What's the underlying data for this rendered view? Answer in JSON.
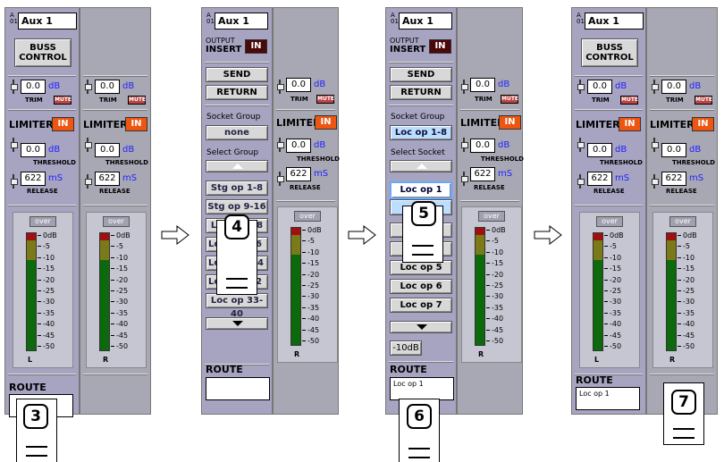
{
  "strip": {
    "channel_letter": "A",
    "channel_number": "01",
    "name": "Aux 1",
    "buss_control": "BUSS\nCONTROL",
    "trim_value": "0.0",
    "trim_unit": "dB",
    "trim_label": "TRIM",
    "mute_label": "MUTE",
    "limiter_label": "LIMITER",
    "in_label": "IN",
    "threshold_value": "0.0",
    "threshold_unit": "dB",
    "threshold_label": "THRESHOLD",
    "release_value": "622",
    "release_unit": "mS",
    "release_label": "RELEASE",
    "over_label": "over",
    "scale": [
      "0dB",
      "-5",
      "-10",
      "-15",
      "-20",
      "-25",
      "-30",
      "-35",
      "-40",
      "-45",
      "-50"
    ],
    "meter_left": "L",
    "meter_right": "R",
    "route_label": "ROUTE",
    "route_value": "Loc op 1"
  },
  "insert": {
    "output_label": "OUTPUT",
    "insert_label": "INSERT",
    "in_label": "IN",
    "send": "SEND",
    "return": "RETURN",
    "socket_group_label": "Socket Group",
    "socket_group_none": "none",
    "socket_group_sel": "Loc op 1-8",
    "select_group_label": "Select Group",
    "select_socket_label": "Select Socket",
    "groups": [
      "Stg op 1-8",
      "Stg op 9-16",
      "Loc op 1-8",
      "Loc op 9-16",
      "Loc op 17-24",
      "Loc op 25-32",
      "Loc op 33-40"
    ],
    "groups_visible": [
      "Stg op 1-8",
      "Stg op 9-16",
      "Loc op 1-8",
      "Lo",
      "6",
      "Loc",
      "24",
      "Lo",
      "32",
      "Loc op 33-40"
    ],
    "sockets": [
      "Loc op 1",
      "Loc op 5",
      "Loc op 6",
      "Loc op 7"
    ],
    "pad": "-10dB"
  },
  "callouts": [
    "3",
    "4",
    "5",
    "6",
    "7"
  ]
}
